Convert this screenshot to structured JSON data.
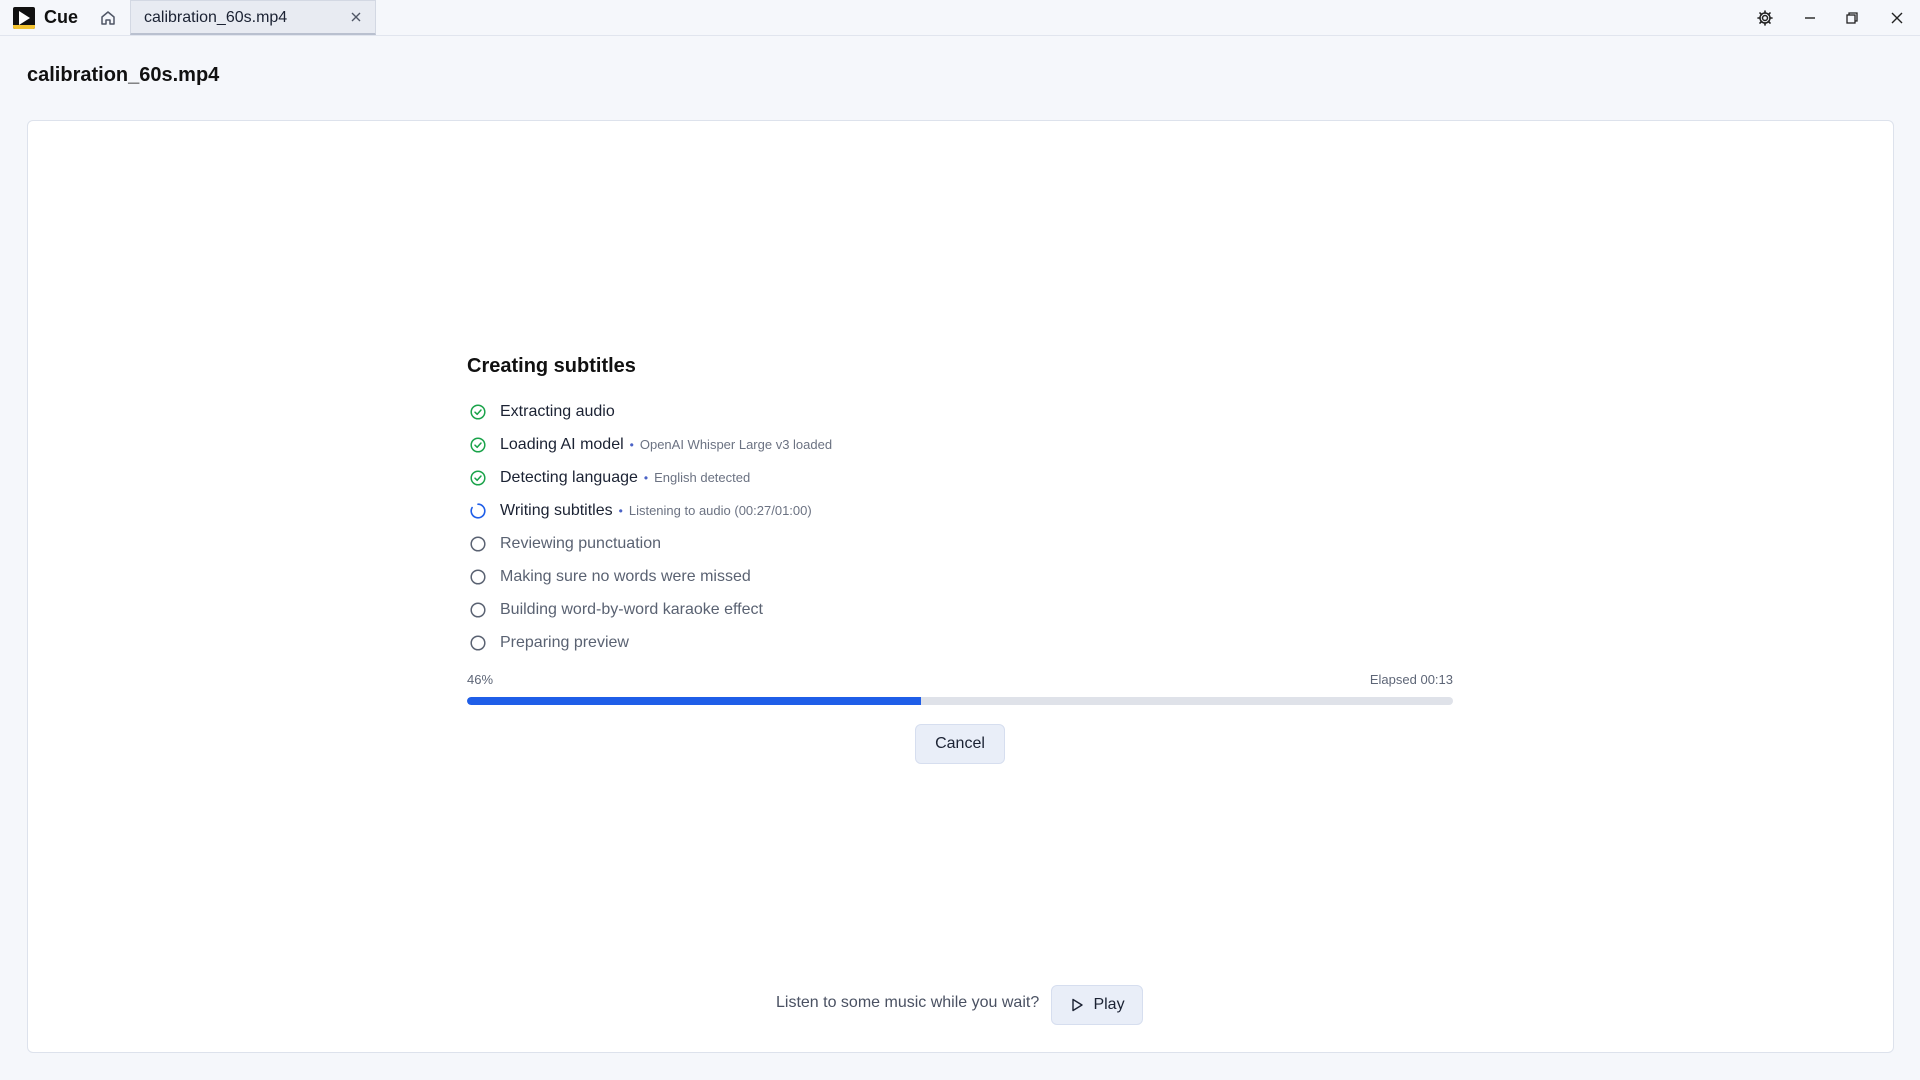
{
  "app": {
    "name": "Cue"
  },
  "tab": {
    "label": "calibration_60s.mp4"
  },
  "header": {
    "file_title": "calibration_60s.mp4"
  },
  "progress": {
    "title": "Creating subtitles",
    "steps": [
      {
        "label": "Extracting audio",
        "detail": "",
        "status": "done"
      },
      {
        "label": "Loading AI model",
        "detail": "OpenAI Whisper Large v3 loaded",
        "status": "done"
      },
      {
        "label": "Detecting language",
        "detail": "English detected",
        "status": "done"
      },
      {
        "label": "Writing subtitles",
        "detail": "Listening to audio (00:27/01:00)",
        "status": "active"
      },
      {
        "label": "Reviewing punctuation",
        "detail": "",
        "status": "pending"
      },
      {
        "label": "Making sure no words were missed",
        "detail": "",
        "status": "pending"
      },
      {
        "label": "Building word-by-word karaoke effect",
        "detail": "",
        "status": "pending"
      },
      {
        "label": "Preparing preview",
        "detail": "",
        "status": "pending"
      }
    ],
    "separator": "•",
    "percent_label": "46%",
    "percent_value": 46,
    "elapsed_label": "Elapsed 00:13",
    "cancel_label": "Cancel"
  },
  "music": {
    "prompt": "Listen to some music while you wait?",
    "play_label": "Play"
  },
  "colors": {
    "accent": "#1f5ee8",
    "done": "#1aa34a",
    "pending": "#5a6272"
  },
  "icons": {
    "home": "home-icon",
    "close": "close-icon",
    "settings": "gear-icon",
    "minimize": "minimize-icon",
    "restore": "restore-icon",
    "window_close": "window-close-icon",
    "step_done": "check-circle-icon",
    "step_active": "spinner-icon",
    "step_pending": "empty-circle-icon",
    "play": "play-icon"
  }
}
